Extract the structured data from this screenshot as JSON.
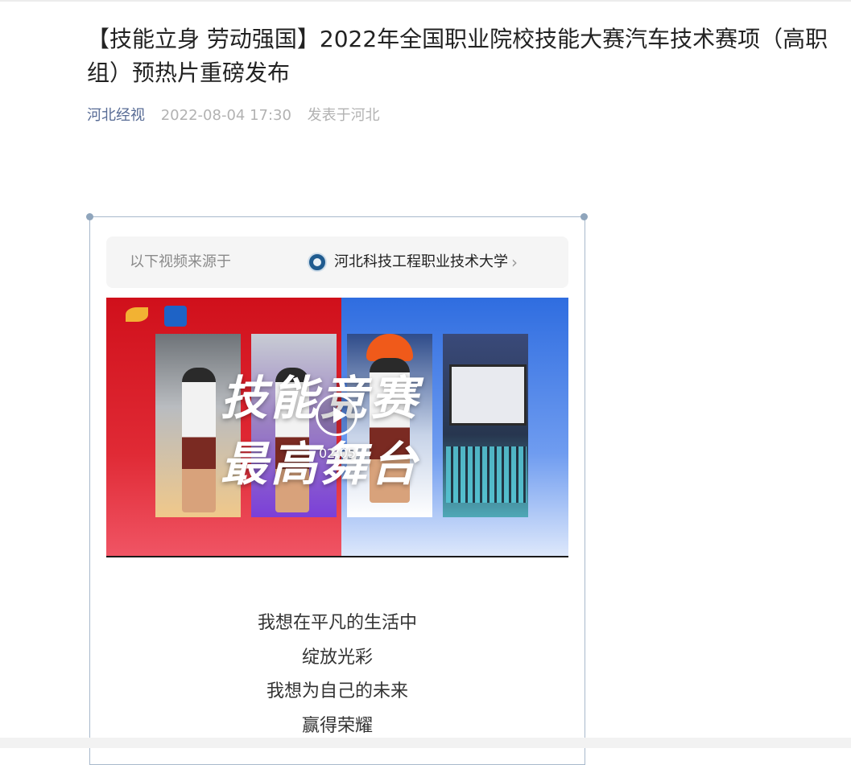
{
  "article": {
    "title": "【技能立身 劳动强国】2022年全国职业院校技能大赛汽车技术赛项（高职组）预热片重磅发布",
    "source": "河北经视",
    "date": "2022-08-04 17:30",
    "location": "发表于河北"
  },
  "video_source": {
    "prefix": "以下视频来源于",
    "account_name": "河北科技工程职业技术大学",
    "account_icon": "school-logo-icon",
    "chevron_icon": "chevron-right-icon"
  },
  "video": {
    "overlay_line1": "技能竞赛",
    "overlay_line2": "最高舞台",
    "duration": "02:05",
    "play_icon": "play-icon"
  },
  "body": {
    "lines": [
      "我想在平凡的生活中",
      "绽放光彩",
      "我想为自己的未来",
      "赢得荣耀"
    ]
  },
  "colors": {
    "source_link": "#576b95",
    "meta_gray": "#b2b2b2",
    "frame_border": "#a8b9cc",
    "video_left": "#d0101b",
    "video_right": "#2f6de0"
  }
}
